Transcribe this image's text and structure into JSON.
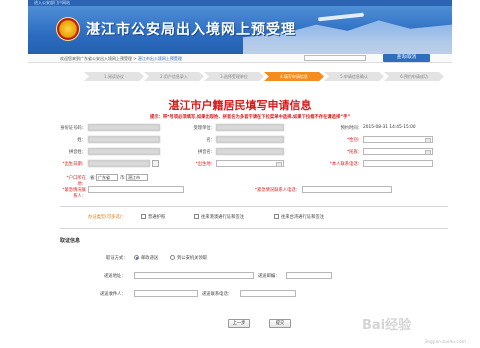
{
  "header": {
    "topbar_text": "进入公安部门户网站",
    "title": "湛江市公安局出入境网上预受理"
  },
  "nav": {
    "breadcrumb_prefix": "欢迎您来到广东省公安出入境网上预受理 >",
    "breadcrumb_current": "湛江市出入境网上预受理",
    "query_button": "查询/取消"
  },
  "steps": [
    {
      "label": "1.阅读协议"
    },
    {
      "label": "2.用户信息录入"
    },
    {
      "label": "3.选择受理单位"
    },
    {
      "label": "4.填写申请信息"
    },
    {
      "label": "5.申请信息确认"
    },
    {
      "label": "6.预约申请成功"
    }
  ],
  "page_title": "湛江市户籍居民填写申请信息",
  "tip": "提示：带*号项必须填写,如果出现姓、拼音名为多音字请在下拉菜单中选择,如果下拉框不存在请选择“手”",
  "form": {
    "id_label": "身份证号码：",
    "unit_label": "受理单位：",
    "appt_label": "预约时间：",
    "appt_value": "2015-08-31 14:45-15:00",
    "surname_label": "姓：",
    "name_label": "名：",
    "gender_label": "*性别：",
    "pinyin_surname_label": "拼音姓：",
    "pinyin_name_label": "拼音名：",
    "ethnicity_label": "*民族：",
    "birthdate_label": "*出生日期：",
    "birthplace_label": "*出生地：",
    "phone_label": "*本人联系电话：",
    "household_label": "*户口所在地：",
    "province_prefix": "省:",
    "province_value": "广东省",
    "city_prefix": "市:",
    "city_value": "湛江市",
    "emergency_contact_label": "*紧急情况联系人：",
    "emergency_phone_label": "*紧急情况联系人电话："
  },
  "business": {
    "label": "办证类型(可多选)：",
    "options": [
      "普通护照",
      "往来港澳通行证和签注",
      "往来台湾通行证和签注"
    ]
  },
  "pickup": {
    "section_title": "取证信息",
    "method_label": "取证方式：",
    "option_mail": "邮政递送",
    "option_self": "到公安机关领取",
    "address_label": "递送地址：",
    "postcode_label": "递送邮编：",
    "recipient_label": "递送收件人：",
    "recipient_phone_label": "递送联系电话："
  },
  "buttons": {
    "prev": "上一步",
    "next": "提交"
  },
  "watermark": {
    "main": "Bai经验",
    "sub": "jingyan.baidu.com"
  },
  "colors": {
    "brand_blue": "#2c6cc0",
    "active_step": "#f38d1e",
    "title_red": "#d61a1a",
    "business_label": "#e07a12"
  }
}
